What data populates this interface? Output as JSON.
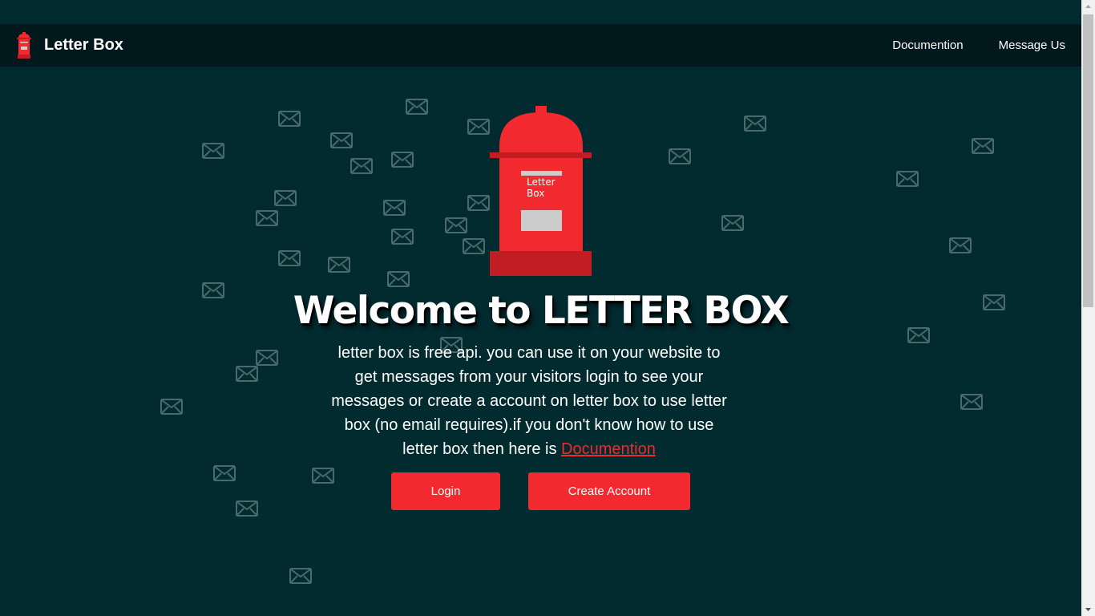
{
  "nav": {
    "brand": "Letter Box",
    "links": [
      "Documention",
      "Message Us"
    ]
  },
  "hero": {
    "postbox_label": "Letter Box",
    "title": "Welcome to LETTER BOX",
    "description": "letter box is free api. you can use it on your website to get messages from your visitors login to see your messages or create a account on letter box to use letter box (no email requires).if you don't know how to use letter box then here is ",
    "doc_link": "Documention",
    "login_label": "Login",
    "create_label": "Create Account"
  },
  "colors": {
    "background": "#022b30",
    "navbar": "#01191c",
    "accent": "#f2292e"
  },
  "icons": {
    "background": "envelope-icon",
    "brand": "postbox-icon"
  }
}
